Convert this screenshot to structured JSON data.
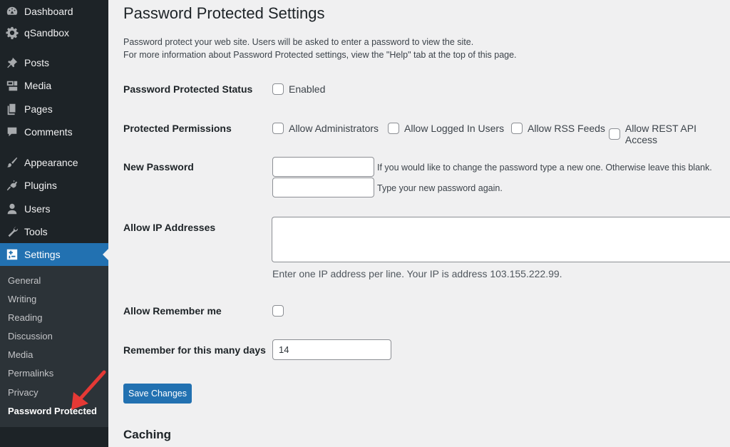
{
  "sidebar": {
    "menu": [
      {
        "label": "Dashboard",
        "icon": "dashboard-icon"
      },
      {
        "label": "qSandbox",
        "icon": "gear-icon"
      },
      {
        "label": "Posts",
        "icon": "pin-icon"
      },
      {
        "label": "Media",
        "icon": "media-icon"
      },
      {
        "label": "Pages",
        "icon": "pages-icon"
      },
      {
        "label": "Comments",
        "icon": "comment-icon"
      },
      {
        "label": "Appearance",
        "icon": "brush-icon"
      },
      {
        "label": "Plugins",
        "icon": "plugin-icon"
      },
      {
        "label": "Users",
        "icon": "user-icon"
      },
      {
        "label": "Tools",
        "icon": "wrench-icon"
      },
      {
        "label": "Settings",
        "icon": "settings-icon"
      }
    ],
    "submenu": [
      "General",
      "Writing",
      "Reading",
      "Discussion",
      "Media",
      "Permalinks",
      "Privacy",
      "Password Protected"
    ]
  },
  "page": {
    "title": "Password Protected Settings",
    "intro_line1": "Password protect your web site. Users will be asked to enter a password to view the site.",
    "intro_line2": "For more information about Password Protected settings, view the \"Help\" tab at the top of this page."
  },
  "form": {
    "status_label": "Password Protected Status",
    "status_enabled": "Enabled",
    "permissions_label": "Protected Permissions",
    "perm_admins": "Allow Administrators",
    "perm_logged_in": "Allow Logged In Users",
    "perm_rss": "Allow RSS Feeds",
    "perm_rest": "Allow REST API Access",
    "new_password_label": "New Password",
    "new_password_desc": "If you would like to change the password type a new one. Otherwise leave this blank.",
    "confirm_password_desc": "Type your new password again.",
    "ip_label": "Allow IP Addresses",
    "ip_desc": "Enter one IP address per line. Your IP is address 103.155.222.99.",
    "remember_label": "Allow Remember me",
    "remember_days_label": "Remember for this many days",
    "remember_days_value": "14",
    "save_button": "Save Changes",
    "caching_title": "Caching"
  },
  "colors": {
    "sidebar_bg": "#1d2327",
    "submenu_bg": "#2c3338",
    "accent": "#2271b1",
    "arrow": "#e53935"
  }
}
